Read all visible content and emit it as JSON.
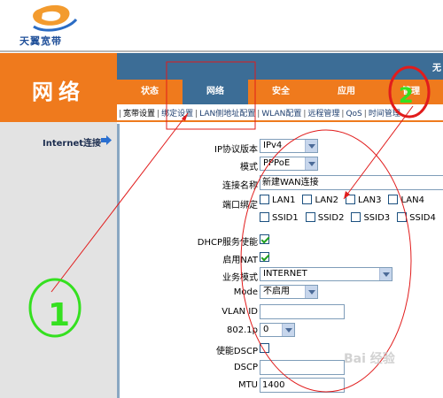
{
  "brand": {
    "logo_text": "天翼宽带"
  },
  "section": {
    "title": "网络"
  },
  "header": {
    "corner_text": "无"
  },
  "tabs": [
    {
      "label": "状态",
      "active": false
    },
    {
      "label": "网络",
      "active": true
    },
    {
      "label": "安全",
      "active": false
    },
    {
      "label": "应用",
      "active": false
    },
    {
      "label": "管理",
      "active": false
    }
  ],
  "submenu": [
    {
      "label": "宽带设置",
      "selected": true
    },
    {
      "label": "绑定设置",
      "selected": false
    },
    {
      "label": "LAN侧地址配置",
      "selected": false
    },
    {
      "label": "WLAN配置",
      "selected": false
    },
    {
      "label": "远程管理",
      "selected": false
    },
    {
      "label": "QoS",
      "selected": false
    },
    {
      "label": "时间管理",
      "selected": false
    }
  ],
  "sidebar": {
    "internet_link": "Internet连接"
  },
  "form": {
    "ip_version": {
      "label": "IP协议版本",
      "value": "IPv4"
    },
    "mode": {
      "label": "模式",
      "value": "PPPoE"
    },
    "connection_name": {
      "label": "连接名称",
      "value": "新建WAN连接"
    },
    "port_binding": {
      "label": "端口绑定",
      "lan": [
        "LAN1",
        "LAN2",
        "LAN3",
        "LAN4"
      ],
      "ssid": [
        "SSID1",
        "SSID2",
        "SSID3",
        "SSID4"
      ]
    },
    "dhcp": {
      "label": "DHCP服务使能",
      "checked": true
    },
    "nat": {
      "label": "启用NAT",
      "checked": true
    },
    "service_mode": {
      "label": "业务模式",
      "value": "INTERNET"
    },
    "vlan_mode": {
      "label": "Mode",
      "value": "不启用"
    },
    "vlan_id": {
      "label": "VLAN ID",
      "value": ""
    },
    "dot1p": {
      "label": "802.1p",
      "value": "0"
    },
    "dscp_enable": {
      "label": "使能DSCP",
      "checked": false
    },
    "dscp": {
      "label": "DSCP",
      "value": ""
    },
    "mtu": {
      "label": "MTU",
      "value": "1400"
    }
  },
  "annotations": {
    "marker_1": "1",
    "marker_2": "2"
  },
  "watermark": {
    "text": "Bai 经验"
  },
  "colors": {
    "orange": "#ef7a1d",
    "blue": "#3c6d96",
    "annotation_red": "#e11c1c",
    "annotation_green": "#35e020"
  }
}
